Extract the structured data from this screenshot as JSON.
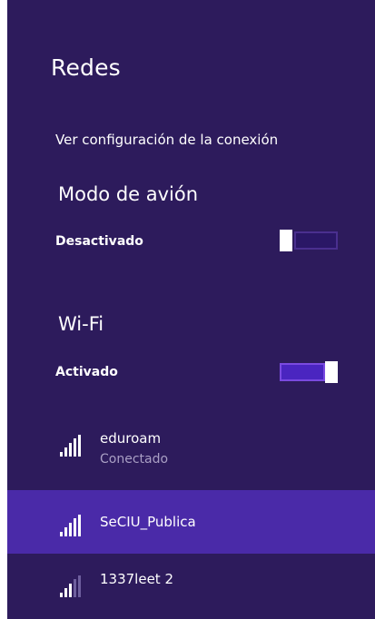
{
  "title": "Redes",
  "connection_settings_link": "Ver configuración de la conexión",
  "airplane_mode": {
    "title": "Modo de avión",
    "state": "Desactivado",
    "on": false
  },
  "wifi": {
    "title": "Wi-Fi",
    "state": "Activado",
    "on": true
  },
  "networks": [
    {
      "name": "eduroam",
      "status": "Conectado",
      "selected": false,
      "signal": "full-signal-icon"
    },
    {
      "name": "SeCIU_Publica",
      "status": "",
      "selected": true,
      "signal": "full-signal-icon"
    },
    {
      "name": "1337leet 2",
      "status": "",
      "selected": false,
      "signal": "partial-signal-icon"
    }
  ],
  "colors": {
    "background": "#2d1b5c",
    "selected_row": "#4a2aa8",
    "toggle_on": "#4a25c0",
    "secondary_text": "#a99fc4"
  }
}
